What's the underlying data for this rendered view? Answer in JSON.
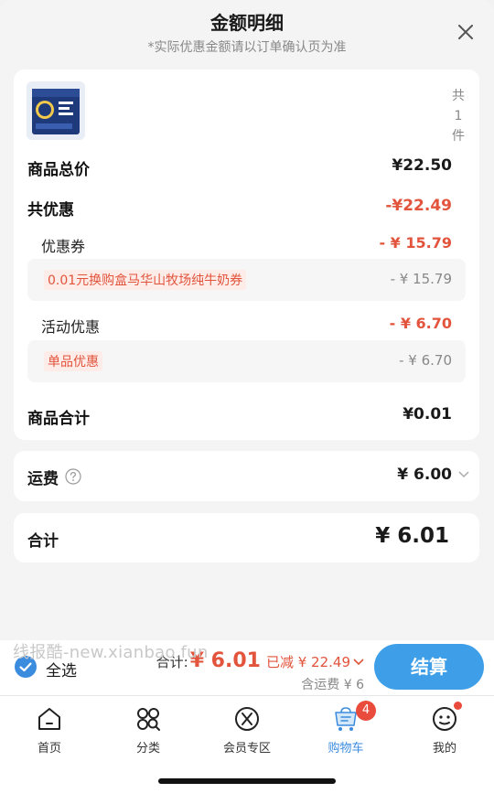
{
  "sheet": {
    "title": "金额明细",
    "subtitle": "*实际优惠金额请以订单确认页为准",
    "close_icon": "close-icon"
  },
  "product": {
    "image_icon": "milk-box-thumbnail",
    "count_chars": [
      "共",
      "1",
      "件"
    ]
  },
  "summary": {
    "goods_total_label": "商品总价",
    "goods_total_value": "¥22.50",
    "discount_label": "共优惠",
    "discount_value": "-¥22.49",
    "coupon_label": "优惠券",
    "coupon_value": "- ¥ 15.79",
    "coupon_detail_tag": "0.01元换购盒马华山牧场纯牛奶券",
    "coupon_detail_value": "- ¥ 15.79",
    "promo_label": "活动优惠",
    "promo_value": "- ¥ 6.70",
    "promo_detail_tag": "单品优惠",
    "promo_detail_value": "- ¥ 6.70",
    "subtotal_label": "商品合计",
    "subtotal_value": "¥0.01"
  },
  "shipping": {
    "label": "运费",
    "value": "¥ 6.00",
    "help_icon": "question-circle-icon"
  },
  "total": {
    "label": "合计",
    "value": "¥ 6.01"
  },
  "watermark": "线报酷-new.xianbao.fun",
  "checkout": {
    "select_all_label": "全选",
    "sum_label": "合计:",
    "sum_amount": "¥ 6.01",
    "discount_text": "已减 ¥ 22.49",
    "shipping_note": "含运费 ¥ 6",
    "pay_label": "结算"
  },
  "tabs": [
    {
      "label": "首页",
      "icon": "home-icon"
    },
    {
      "label": "分类",
      "icon": "category-icon"
    },
    {
      "label": "会员专区",
      "icon": "member-icon"
    },
    {
      "label": "购物车",
      "icon": "cart-icon",
      "active": true
    },
    {
      "label": "我的",
      "icon": "profile-icon"
    }
  ],
  "cart_badge": "4",
  "colors": {
    "accent_blue": "#3b8bdf",
    "discount_red": "#e2543c",
    "pay_button": "#3e9fe8"
  }
}
